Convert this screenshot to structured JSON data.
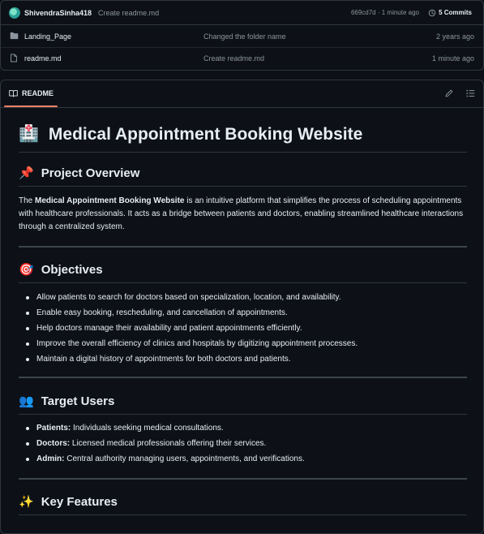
{
  "commit_bar": {
    "user": "ShivendraSinha418",
    "message": "Create readme.md",
    "meta": "669cd7d · 1 minute ago",
    "commits_label": "5 Commits"
  },
  "files": [
    {
      "name": "Landing_Page",
      "type": "folder",
      "commit": "Changed the folder name",
      "time": "2 years ago"
    },
    {
      "name": "readme.md",
      "type": "file",
      "commit": "Create readme.md",
      "time": "1 minute ago"
    }
  ],
  "readme": {
    "tab_label": "README",
    "title_emoji": "🏥",
    "title": "Medical Appointment Booking Website",
    "overview": {
      "emoji": "📌",
      "heading": "Project Overview",
      "intro": "The ",
      "bold": "Medical Appointment Booking Website",
      "rest": " is an intuitive platform that simplifies the process of scheduling appointments with healthcare professionals. It acts as a bridge between patients and doctors, enabling streamlined healthcare interactions through a centralized system."
    },
    "objectives": {
      "emoji": "🎯",
      "heading": "Objectives",
      "items": [
        "Allow patients to search for doctors based on specialization, location, and availability.",
        "Enable easy booking, rescheduling, and cancellation of appointments.",
        "Help doctors manage their availability and patient appointments efficiently.",
        "Improve the overall efficiency of clinics and hospitals by digitizing appointment processes.",
        "Maintain a digital history of appointments for both doctors and patients."
      ]
    },
    "target_users": {
      "emoji": "👥",
      "heading": "Target Users",
      "items": [
        {
          "label": "Patients:",
          "text": " Individuals seeking medical consultations."
        },
        {
          "label": "Doctors:",
          "text": " Licensed medical professionals offering their services."
        },
        {
          "label": "Admin:",
          "text": " Central authority managing users, appointments, and verifications."
        }
      ]
    },
    "key_features": {
      "emoji": "✨",
      "heading": "Key Features"
    }
  }
}
